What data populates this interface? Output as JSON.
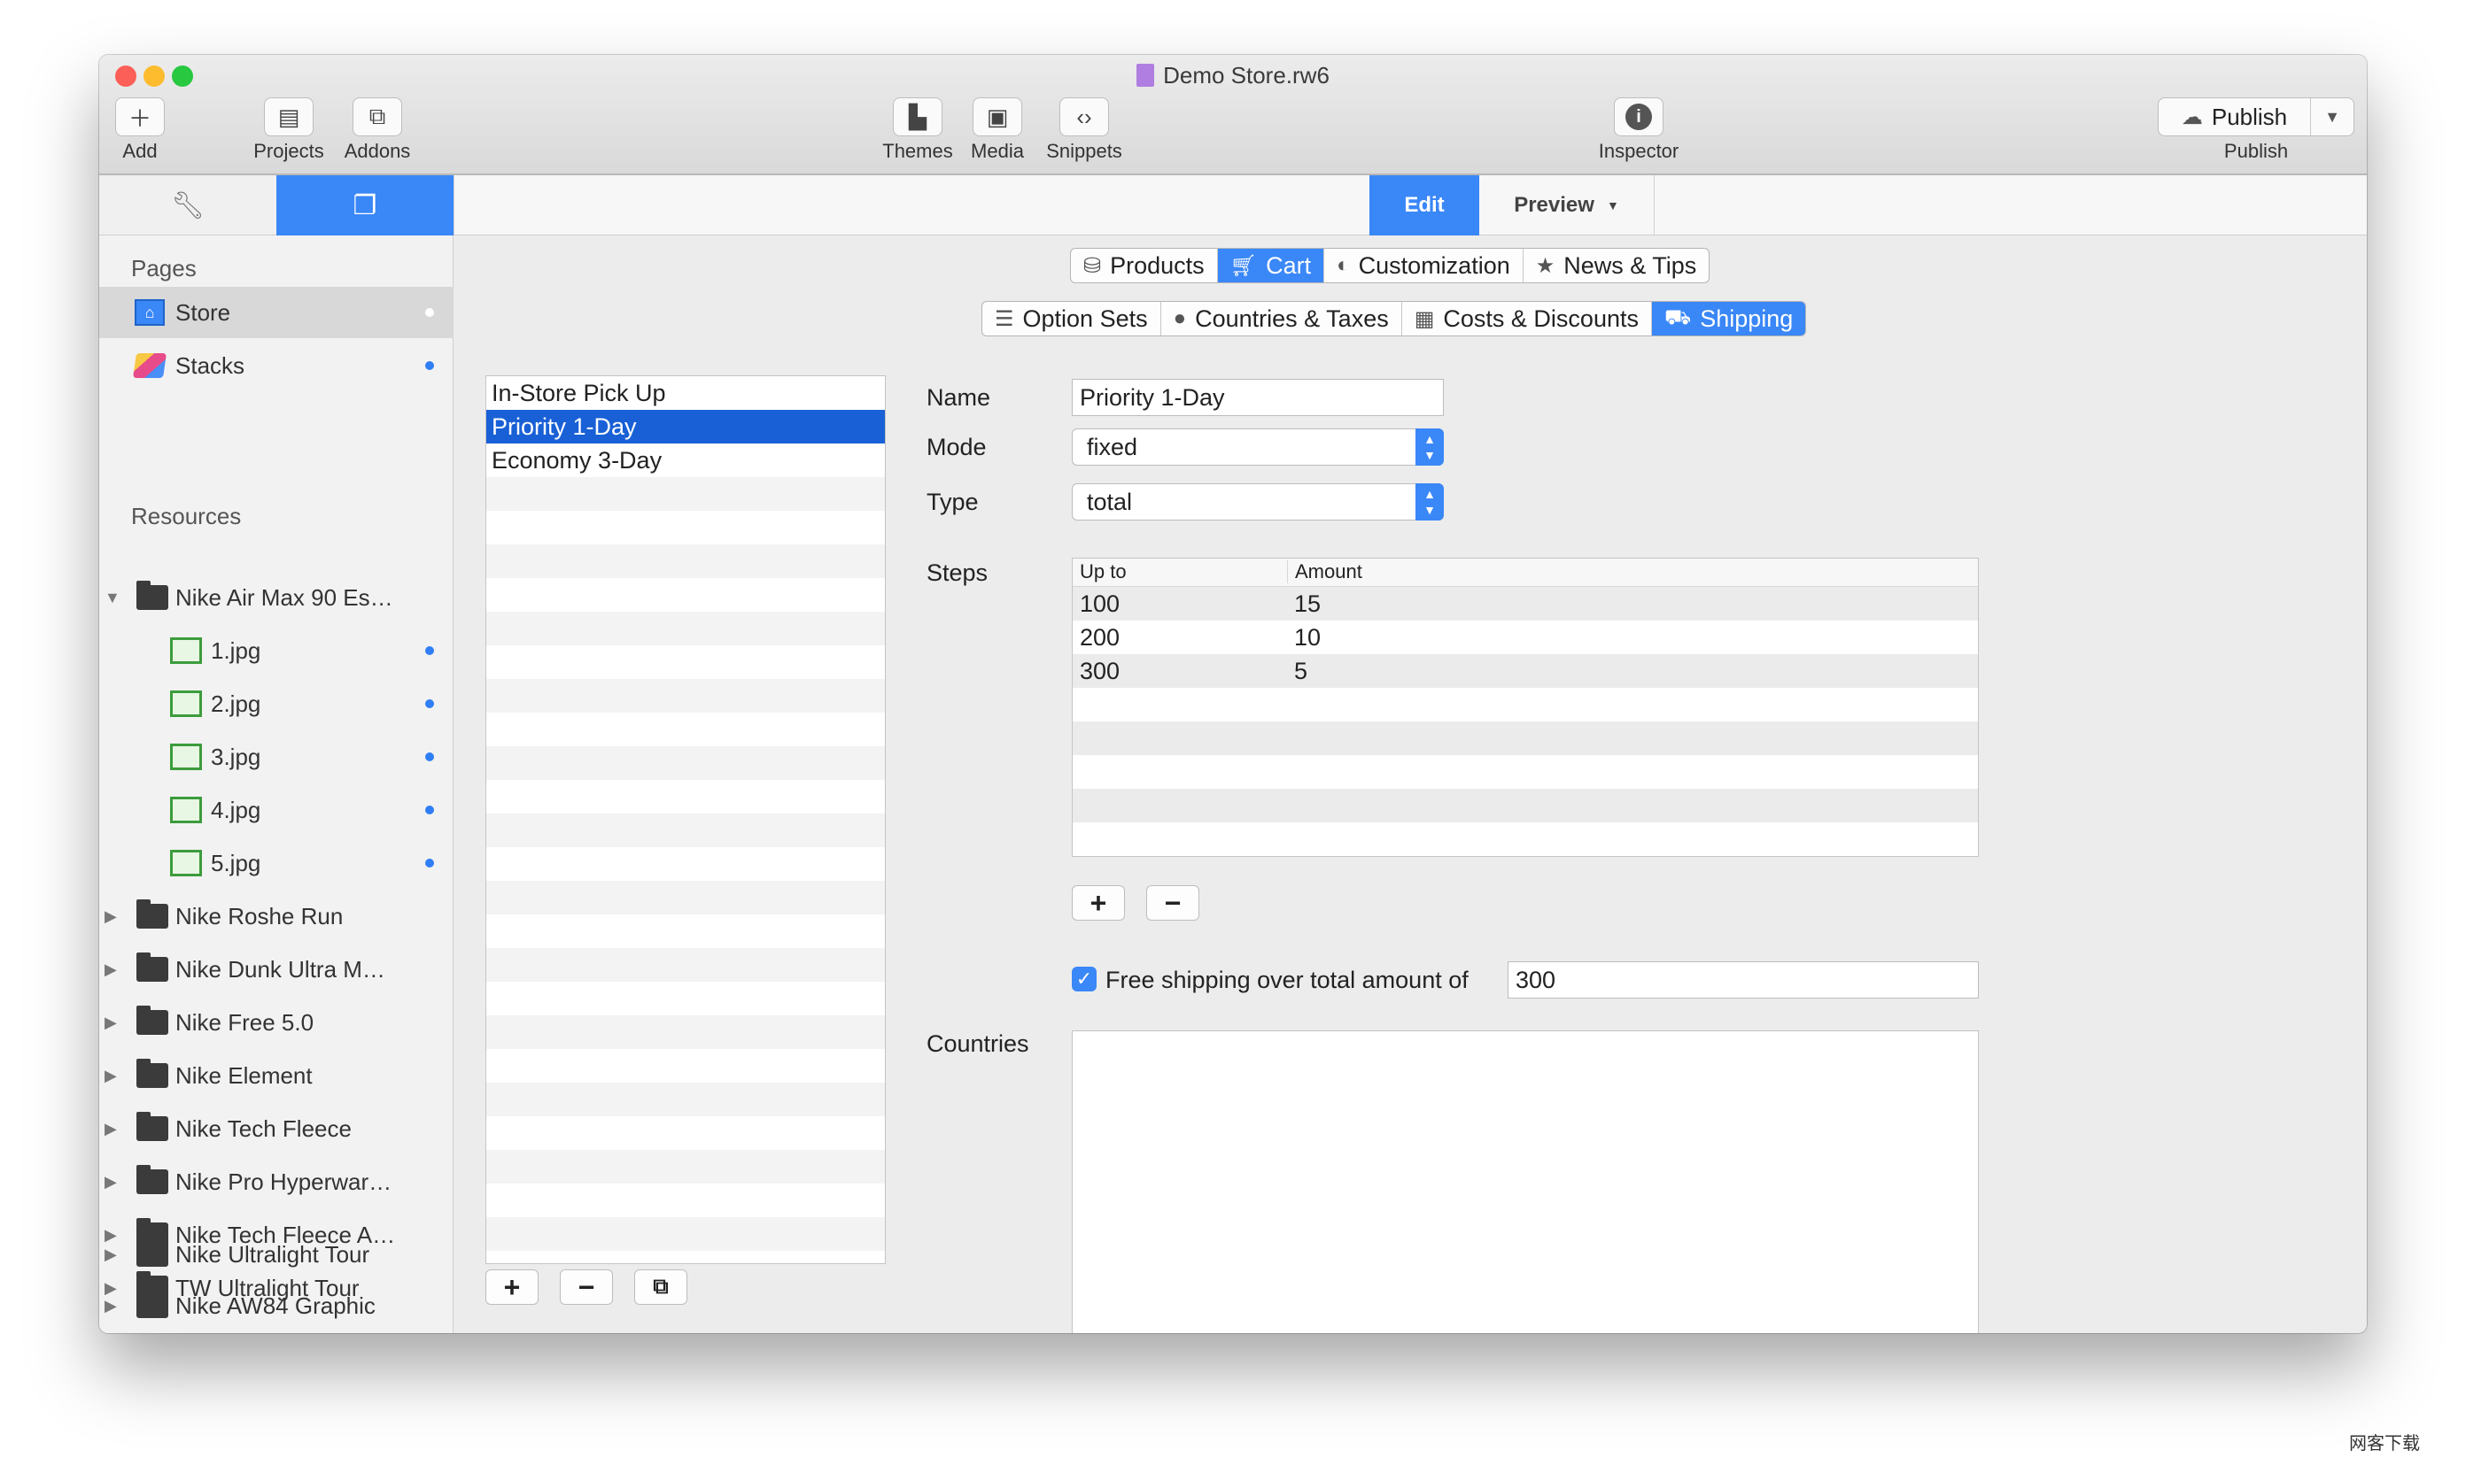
{
  "window": {
    "title": "Demo Store.rw6"
  },
  "toolbar": {
    "add": "Add",
    "projects": "Projects",
    "addons": "Addons",
    "themes": "Themes",
    "media": "Media",
    "snippets": "Snippets",
    "inspector": "Inspector",
    "publish_button": "Publish",
    "publish_label": "Publish"
  },
  "editbar": {
    "edit": "Edit",
    "preview": "Preview"
  },
  "sidebar": {
    "pages_header": "Pages",
    "pages": [
      {
        "label": "Store"
      },
      {
        "label": "Stacks"
      }
    ],
    "resources_header": "Resources",
    "resources": [
      {
        "label": "Nike Air Max 90 Es…"
      },
      {
        "label": "1.jpg"
      },
      {
        "label": "2.jpg"
      },
      {
        "label": "3.jpg"
      },
      {
        "label": "4.jpg"
      },
      {
        "label": "5.jpg"
      },
      {
        "label": "Nike Roshe Run"
      },
      {
        "label": "Nike Dunk Ultra M…"
      },
      {
        "label": "Nike Free 5.0"
      },
      {
        "label": "Nike Element"
      },
      {
        "label": "Nike Tech Fleece"
      },
      {
        "label": "Nike Pro Hyperwar…"
      },
      {
        "label": "Nike Tech Fleece A…"
      },
      {
        "label": "TW Ultralight Tour"
      },
      {
        "label": "Nike Ultralight Tour"
      },
      {
        "label": "Nike AW84 Graphic"
      }
    ]
  },
  "tabs_top": [
    "Products",
    "Cart",
    "Customization",
    "News & Tips"
  ],
  "tabs_sub": [
    "Option Sets",
    "Countries & Taxes",
    "Costs & Discounts",
    "Shipping"
  ],
  "shipping_methods": [
    "In-Store Pick Up",
    "Priority 1-Day",
    "Economy 3-Day"
  ],
  "form": {
    "name_label": "Name",
    "name_value": "Priority 1-Day",
    "mode_label": "Mode",
    "mode_value": "fixed",
    "type_label": "Type",
    "type_value": "total",
    "steps_label": "Steps",
    "steps_headers": [
      "Up to",
      "Amount"
    ],
    "steps": [
      {
        "upto": "100",
        "amount": "15"
      },
      {
        "upto": "200",
        "amount": "10"
      },
      {
        "upto": "300",
        "amount": "5"
      }
    ],
    "free_shipping_label": "Free shipping over total amount of",
    "free_shipping_value": "300",
    "countries_label": "Countries"
  },
  "watermark": "网客下载"
}
